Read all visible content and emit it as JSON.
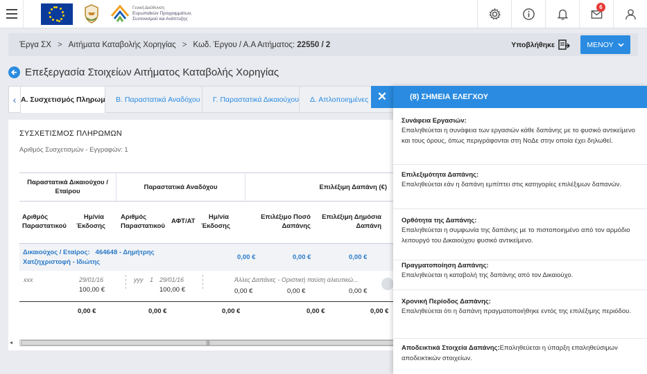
{
  "header": {
    "logo_lines": [
      "Γενική Διεύθυνση",
      "Ευρωπαϊκών Προγραμμάτων,",
      "Συντονισμού και Ανάπτυξης"
    ],
    "mail_badge": "6",
    "icons": [
      "settings-icon",
      "info-icon",
      "bell-icon",
      "mail-icon",
      "user-icon"
    ]
  },
  "breadcrumb": {
    "items": [
      "Έργα ΣΧ",
      "Αιτήματα Καταβολής Χορηγίας"
    ],
    "last_prefix": "Κωδ. Έργου / Α.Α Αιτήματος: ",
    "last_value": "22550 / 2",
    "separator": ">"
  },
  "status": {
    "label": "Υποβλήθηκε"
  },
  "menu_button": {
    "label": "ΜΕΝΟΥ"
  },
  "page": {
    "title": "Επεξεργασία Στοιχείων Αιτήματος Καταβολής Χορηγίας"
  },
  "tabs": [
    "Α. Συσχετισμός Πληρωμών",
    "Β. Παραστατικά Αναδόχου",
    "Γ. Παραστατικά Δικαιούχου",
    "Δ. Απλοποιημένες"
  ],
  "card": {
    "title": "ΣΥΣΧΕΤΙΣΜΟΣ ΠΛΗΡΩΜΩΝ",
    "subtitle": "Αριθμός Συσχετισμών - Εγγραφών: 1",
    "groups": [
      "Παραστατικά Δικαιούχου / Εταίρου",
      "Παραστατικά Αναδόχου",
      "Επιλέξιμη Δαπάνη (€)"
    ],
    "columns": [
      "Αριθμός Παραστατικού",
      "Ημ/νία Έκδοσης",
      "Αριθμός Παραστατικού",
      "ΑΦΤ/ΑΤ",
      "Ημ/νία Έκδοσης",
      "Επιλέξιμο Ποσό Δαπάνης",
      "Επιλέξιμη Δημόσια Δαπάνη"
    ],
    "beneficiary_row": {
      "label": "Δικαιούχος / Εταίρος:",
      "value": "464648 - Δημήτρης Χατζηχριστοφή - Ιδιώτης",
      "amounts": [
        "0,00 €",
        "0,00 €",
        "0,00 €"
      ]
    },
    "detail_row": {
      "doc_no": "xxx",
      "doc_date": "29/01/16",
      "doc_amount": "100,00 €",
      "contractor_doc": "yyy",
      "afm": "1",
      "contractor_date": "29/01/16",
      "contractor_amount": "100,00 €",
      "category": "Άλλες Δαπάνες - Οριστική παύση αλιευτικώ...",
      "amounts": [
        "0,00 €",
        "0,00 €",
        "0,00 €"
      ]
    },
    "totals": [
      "0,00 €",
      "0,00 €",
      "0,00 €",
      "0,00 €",
      "0,00 €"
    ]
  },
  "panel": {
    "title": "(8) ΣΗΜΕΙΑ ΕΛΕΓΧΟΥ",
    "checkpoints": [
      {
        "title": "Συνάφεια Εργασιών:",
        "desc": "Επαληθεύεται η συνάφεια των εργασιών κάθε δαπάνης με το φυσικό αντικείμενο και τους όρους, όπως περιγράφονται στη ΝοΔε στην οποία έχει δηλωθεί."
      },
      {
        "title": "Επιλεξιμότητα Δαπάνης:",
        "desc": "Επαληθεύεται εάν η δαπάνη εμπίπτει στις κατηγορίες επιλέξιμων δαπανών."
      },
      {
        "title": "Ορθότητα της Δαπάνης:",
        "desc": "Επαληθεύεται η συμφωνία της δαπάνης με το πιστοποιημένο από τον αρμόδιο λειτουργό του Δικαιούχου φυσικό αντικείμενο."
      },
      {
        "title": "Πραγματοποίηση Δαπάνης:",
        "desc": "Επαληθεύεται η καταβολή της δαπάνης από τον Δικαιούχο."
      },
      {
        "title": "Χρονική Περίοδος Δαπάνης:",
        "desc": "Επαληθεύεται ότι η δαπάνη πραγματοποιήθηκε εντός της επιλέξιμης περιόδου."
      },
      {
        "title": "Αποδεικτικά Στοιχεία Δαπάνης:",
        "desc": "Επαληθεύεται η ύπαρξη επαληθεύσιμων αποδεικτικών στοιχείων."
      }
    ]
  }
}
